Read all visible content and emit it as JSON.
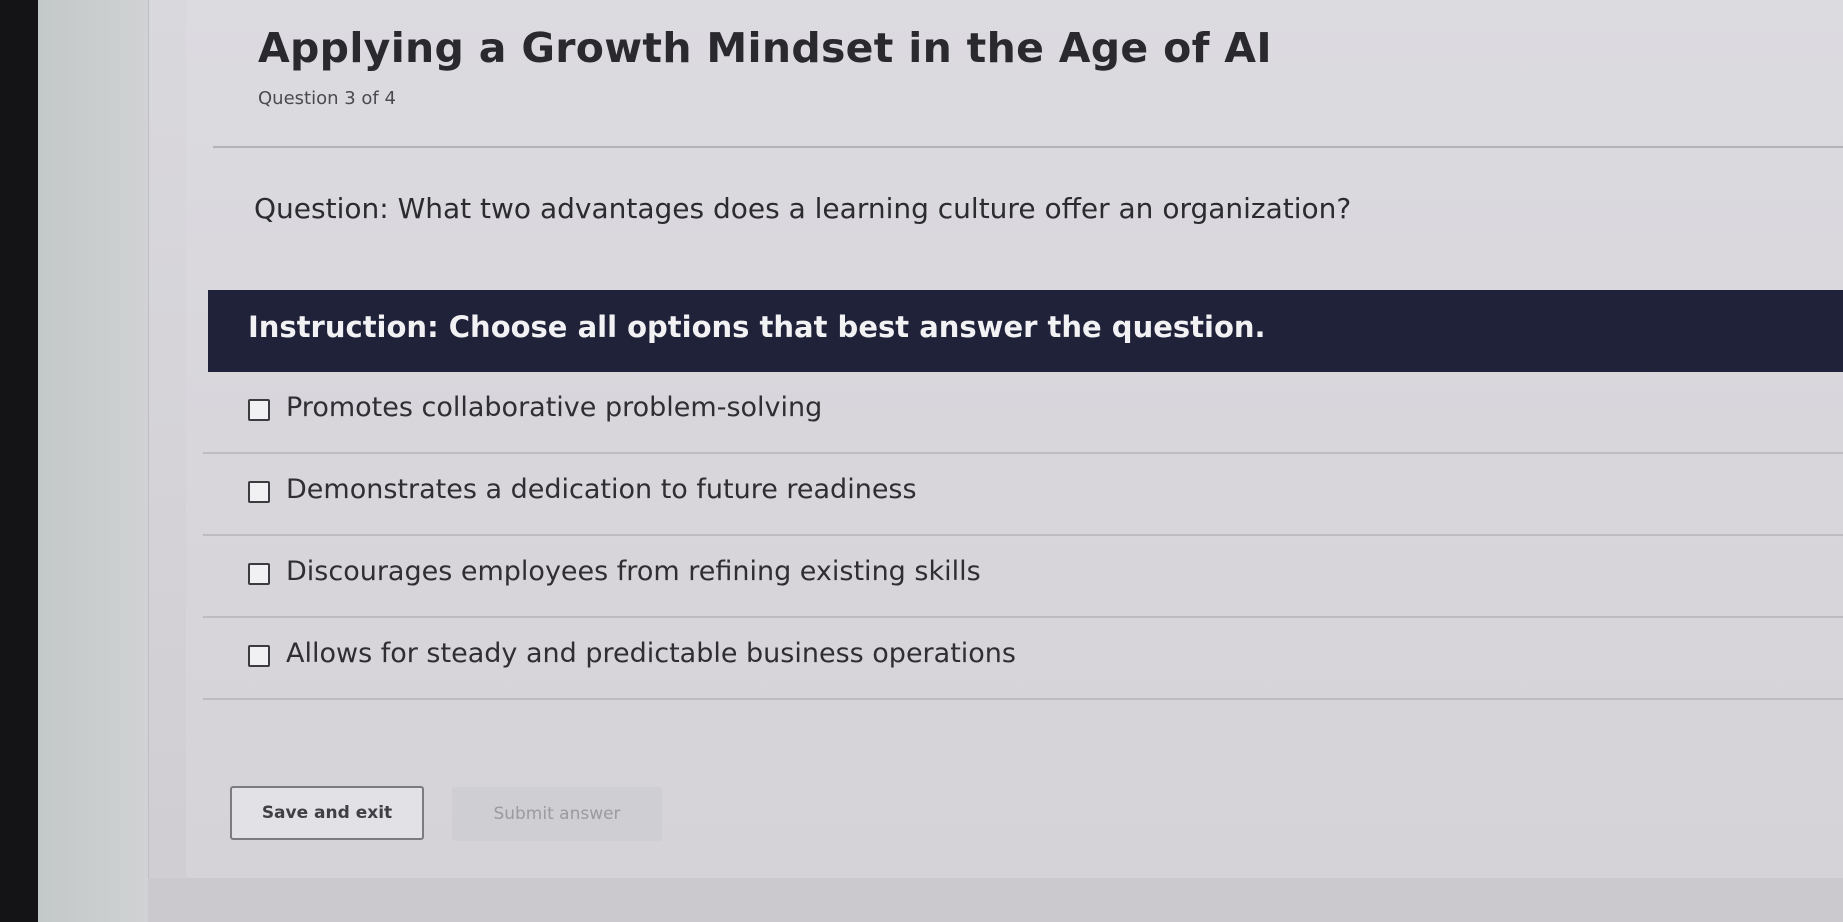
{
  "course": {
    "title": "Applying a Growth Mindset in the Age of AI",
    "progress": "Question 3 of 4"
  },
  "question": {
    "text": "Question: What two advantages does a learning culture offer an organization?"
  },
  "instruction": {
    "text": "Instruction: Choose all options that best answer the question."
  },
  "options": [
    {
      "label": "Promotes collaborative problem-solving",
      "checked": false
    },
    {
      "label": "Demonstrates a dedication to future readiness",
      "checked": false
    },
    {
      "label": "Discourages employees from refining existing skills",
      "checked": false
    },
    {
      "label": "Allows for steady and predictable business operations",
      "checked": false
    }
  ],
  "actions": {
    "save_label": "Save and exit",
    "submit_label": "Submit answer"
  },
  "colors": {
    "instruction_bar": "#20223a",
    "page_background": "#d9d8dc"
  }
}
